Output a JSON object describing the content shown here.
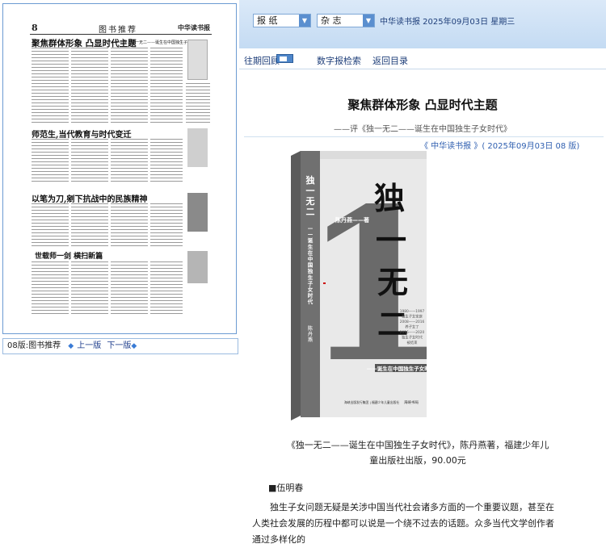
{
  "paper": {
    "page_number": "8",
    "section_title": "图书推荐",
    "masthead": "中华读书报",
    "headlines": [
      "聚焦群体形象 凸显时代主题",
      "师范生,当代教育与时代变迁",
      "以笔为刀,剜下抗战中的民族精神",
      "世载师一剑 横扫新篇"
    ],
    "sub_headline": "——评《独一无二——诞生在中国独生子女时代》"
  },
  "pager": {
    "label": "08版:图书推荐",
    "prev": "上一版",
    "next": "下一版"
  },
  "topbar": {
    "select_paper": "报 纸",
    "select_magazine": "杂 志",
    "date_info": "中华读书报  2025年09月03日  星期三"
  },
  "nav": {
    "back_issues": "往期回顾",
    "search": "数字报检索",
    "catalog": "返回目录"
  },
  "article": {
    "title": "聚焦群体形象 凸显时代主题",
    "subtitle": "——评《独一无二——诞生在中国独生子女时代》",
    "source": "《 中华读书报 》( 2025年09月03日    08 版)",
    "caption": "《独一无二——诞生在中国独生子女时代》，陈丹燕著，福建少年儿童出版社出版，90.00元",
    "author": "■伍明春",
    "body": "独生子女问题无疑是关涉中国当代社会诸多方面的一个重要议题，甚至在人类社会发展的历程中都可以说是一个绕不过去的话题。众多当代文学创作者通过多样化的"
  },
  "book_cover": {
    "big_numeral": "1",
    "title_vertical": "独一无二",
    "subtitle_vertical": "——诞生在中国独生子女时代",
    "author_mark": "陈丹燕",
    "author_suffix": "著",
    "timeline": "1980——1997\n独生子女家庭\n2008——2016\n养子女了\n2016——2020\n独生子女时代\n被结束",
    "publisher": "海峡出版发行集团 | 福建少年儿童出版社",
    "brand": "海峡书局"
  },
  "colors": {
    "topbar_start": "#dbe9f8",
    "topbar_end": "#c4dbf3",
    "link_blue": "#1f3f7a",
    "source_blue": "#2f5fb0"
  }
}
